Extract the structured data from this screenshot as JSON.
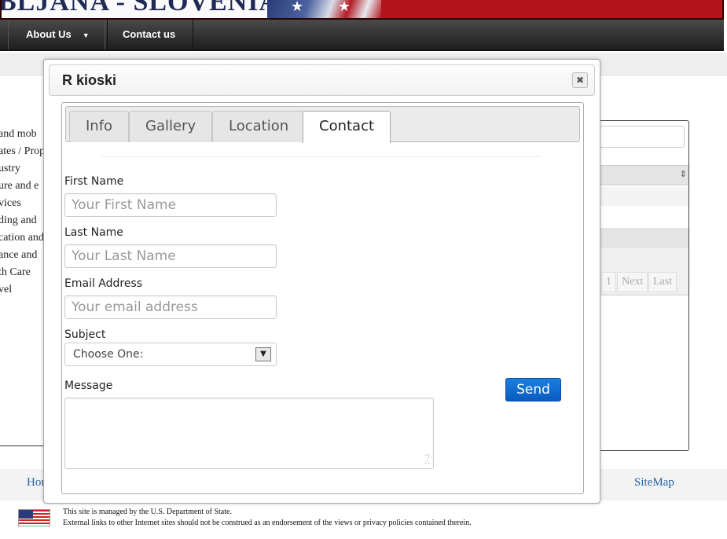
{
  "banner": {
    "title": "BLJANA - SLOVENIA"
  },
  "nav": {
    "about_label": "About Us",
    "contact_label": "Contact us"
  },
  "categories": [
    "and mob",
    "ates / Prop",
    "ustry",
    "ure and e",
    "vices",
    "ding and",
    "cation and",
    "ance and",
    "th Care",
    "vel"
  ],
  "pager": {
    "page": "1",
    "next": "Next",
    "last": "Last"
  },
  "footer": {
    "home_link": "Hon",
    "sitemap_link": "SiteMap",
    "managed_text": "This site is managed by the U.S. Department of State.",
    "disclaimer_text": "External links to other Internet sites should not be construed as an endorsement of the views or privacy policies contained therein."
  },
  "dialog": {
    "title": "R kioski",
    "close_symbol": "✖",
    "tabs": [
      "Info",
      "Gallery",
      "Location",
      "Contact"
    ],
    "active_tab": "Contact",
    "form": {
      "first_name_label": "First Name",
      "first_name_placeholder": "Your First Name",
      "last_name_label": "Last Name",
      "last_name_placeholder": "Your Last Name",
      "email_label": "Email Address",
      "email_placeholder": "Your email address",
      "subject_label": "Subject",
      "subject_value": "Choose One:",
      "message_label": "Message",
      "send_label": "Send"
    }
  },
  "colors": {
    "accent": "#0a6ad4",
    "banner_red": "#b3141c",
    "link": "#2563a8"
  }
}
